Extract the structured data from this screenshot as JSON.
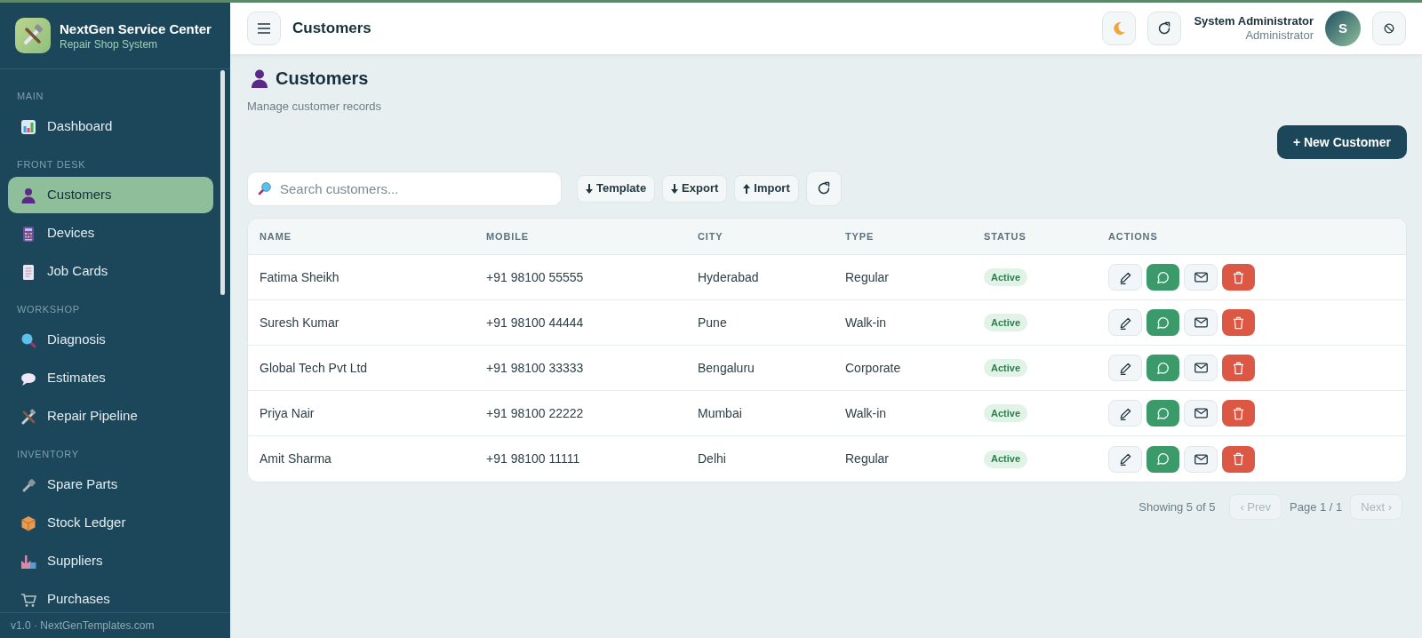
{
  "brand": {
    "title": "NextGen Service Center",
    "subtitle": "Repair Shop System"
  },
  "sidebar": {
    "sections": [
      {
        "heading": "MAIN",
        "items": [
          {
            "label": "Dashboard",
            "selected": false
          }
        ]
      },
      {
        "heading": "FRONT DESK",
        "items": [
          {
            "label": "Customers",
            "selected": true
          },
          {
            "label": "Devices",
            "selected": false
          },
          {
            "label": "Job Cards",
            "selected": false
          }
        ]
      },
      {
        "heading": "WORKSHOP",
        "items": [
          {
            "label": "Diagnosis",
            "selected": false
          },
          {
            "label": "Estimates",
            "selected": false
          },
          {
            "label": "Repair Pipeline",
            "selected": false
          }
        ]
      },
      {
        "heading": "INVENTORY",
        "items": [
          {
            "label": "Spare Parts",
            "selected": false
          },
          {
            "label": "Stock Ledger",
            "selected": false
          },
          {
            "label": "Suppliers",
            "selected": false
          },
          {
            "label": "Purchases",
            "selected": false
          }
        ]
      }
    ],
    "footer": "v1.0 · NextGenTemplates.com"
  },
  "header": {
    "title": "Customers",
    "user": {
      "name": "System Administrator",
      "role": "Administrator",
      "initial": "S"
    }
  },
  "page": {
    "title": "Customers",
    "subtitle": "Manage customer records",
    "primary_button": "+ New Customer"
  },
  "toolbar": {
    "search": {
      "placeholder": "Search customers..."
    },
    "buttons": [
      "Template",
      "Export",
      "Import"
    ]
  },
  "table": {
    "columns": [
      "NAME",
      "MOBILE",
      "CITY",
      "TYPE",
      "STATUS",
      "ACTIONS"
    ],
    "rows": [
      {
        "name": "Fatima Sheikh",
        "mobile": "+91 98100 55555",
        "city": "Hyderabad",
        "type": "Regular",
        "status": "Active"
      },
      {
        "name": "Suresh Kumar",
        "mobile": "+91 98100 44444",
        "city": "Pune",
        "type": "Walk-in",
        "status": "Active"
      },
      {
        "name": "Global Tech Pvt Ltd",
        "mobile": "+91 98100 33333",
        "city": "Bengaluru",
        "type": "Corporate",
        "status": "Active"
      },
      {
        "name": "Priya Nair",
        "mobile": "+91 98100 22222",
        "city": "Mumbai",
        "type": "Walk-in",
        "status": "Active"
      },
      {
        "name": "Amit Sharma",
        "mobile": "+91 98100 11111",
        "city": "Delhi",
        "type": "Regular",
        "status": "Active"
      }
    ]
  },
  "pagination": {
    "summary": "Showing 5 of 5",
    "prev": {
      "label": "‹ Prev",
      "disabled": true
    },
    "page": "Page 1 / 1",
    "next": {
      "label": "Next ›",
      "disabled": true
    }
  }
}
